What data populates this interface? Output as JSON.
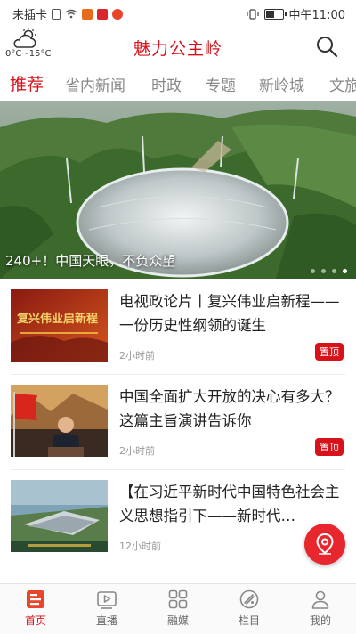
{
  "status_bar": {
    "carrier": "未插卡",
    "time": "中午11:00"
  },
  "header": {
    "app_title": "魅力公主岭",
    "weather": {
      "icon": "partly-cloudy-icon",
      "temperature": "0°C~15°C"
    },
    "search_icon": "search-icon"
  },
  "tabs": [
    {
      "label": "推荐",
      "active": true
    },
    {
      "label": "省内新闻",
      "active": false
    },
    {
      "label": "时政",
      "active": false
    },
    {
      "label": "专题",
      "active": false
    },
    {
      "label": "新岭城",
      "active": false
    },
    {
      "label": "文旅",
      "active": false
    }
  ],
  "banner": {
    "caption": "240+！中国天眼，不负众望",
    "slide_count": 4,
    "active_slide": 4
  },
  "news": [
    {
      "title": "电视政论片丨复兴伟业启新程——一份历史性纲领的诞生",
      "time": "2小时前",
      "badge": "置顶",
      "thumb_text": "复兴伟业启新程"
    },
    {
      "title": "中国全面扩大开放的决心有多大？这篇主旨演讲告诉你",
      "time": "2小时前",
      "badge": "置顶"
    },
    {
      "title": "【在习近平新时代中国特色社会主义思想指引下——新时代…",
      "time": "12小时前",
      "badge": ""
    }
  ],
  "bottom_nav": [
    {
      "label": "首页",
      "icon": "home-news-icon",
      "active": true
    },
    {
      "label": "直播",
      "icon": "live-tv-icon",
      "active": false
    },
    {
      "label": "融媒",
      "icon": "media-grid-icon",
      "active": false
    },
    {
      "label": "栏目",
      "icon": "column-icon",
      "active": false
    },
    {
      "label": "我的",
      "icon": "profile-icon",
      "active": false
    }
  ],
  "colors": {
    "accent": "#d7121b",
    "fab": "#e8262e"
  }
}
